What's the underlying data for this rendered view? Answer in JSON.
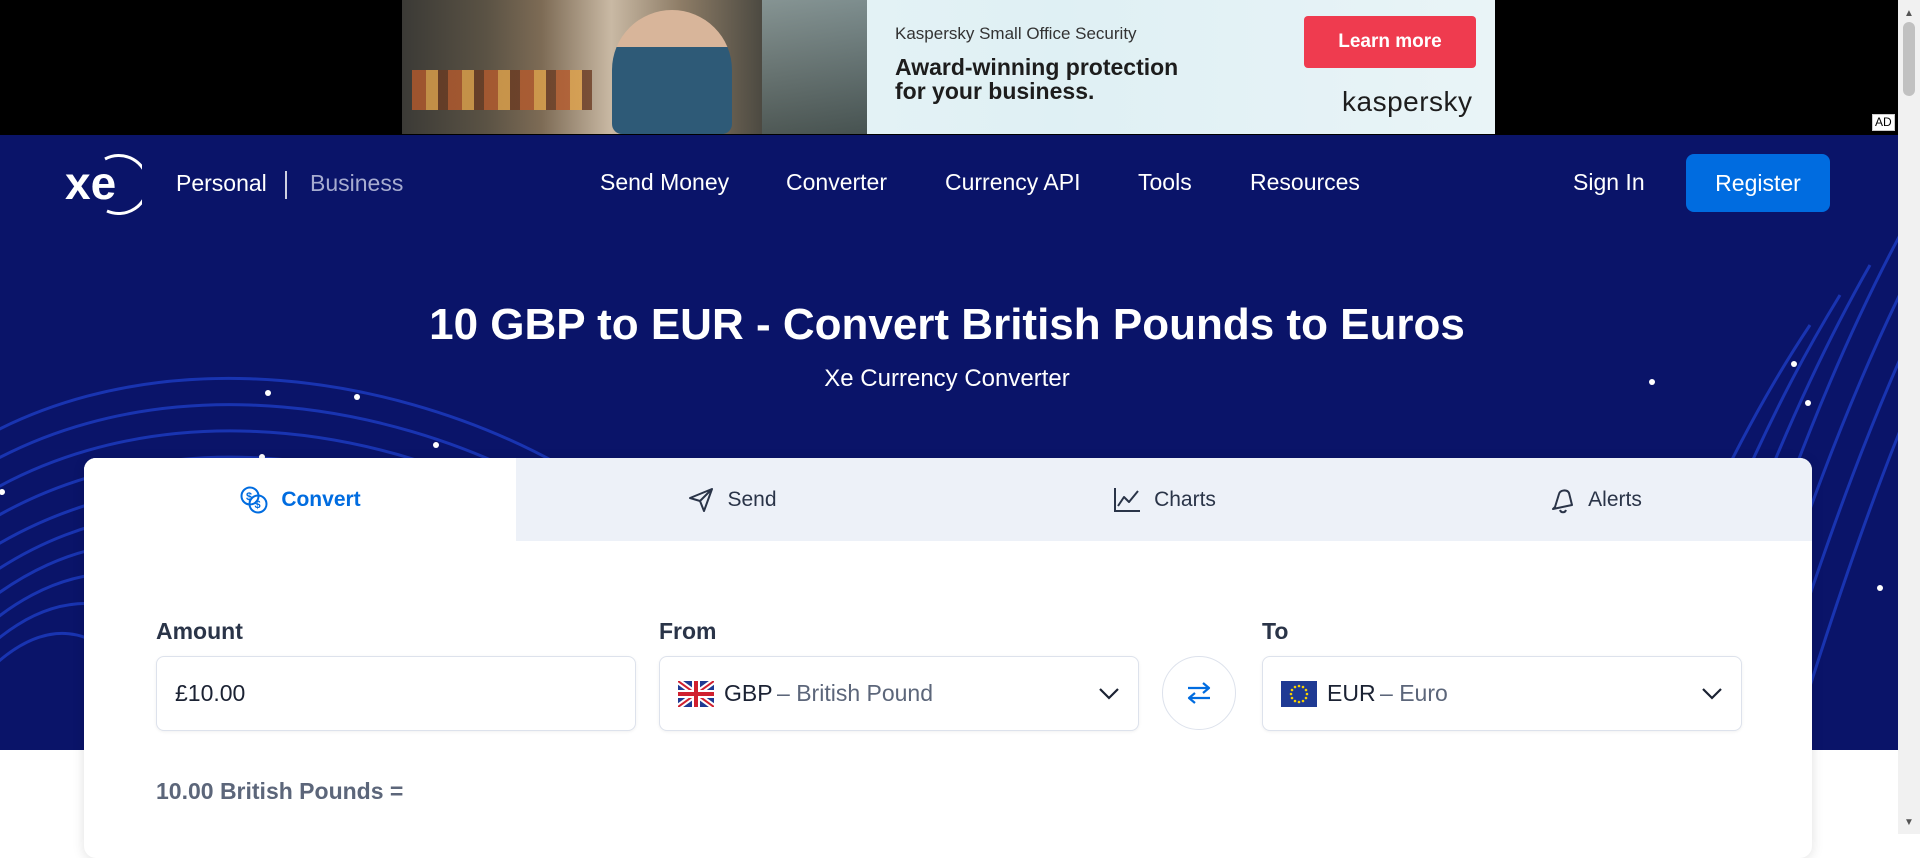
{
  "ad": {
    "small_text": "Kaspersky Small Office Security",
    "headline_line1": "Award-winning protection",
    "headline_line2": "for your business.",
    "cta": "Learn more",
    "brand": "kaspersky",
    "tag": "AD"
  },
  "nav": {
    "logo_text": "xe",
    "personal": "Personal",
    "business": "Business",
    "links": [
      "Send Money",
      "Converter",
      "Currency API",
      "Tools",
      "Resources"
    ],
    "sign_in": "Sign In",
    "register": "Register"
  },
  "hero": {
    "title": "10 GBP to EUR - Convert British Pounds to Euros",
    "subtitle": "Xe Currency Converter"
  },
  "tabs": [
    {
      "label": "Convert",
      "icon": "currency-exchange-icon",
      "active": true
    },
    {
      "label": "Send",
      "icon": "paper-plane-icon",
      "active": false
    },
    {
      "label": "Charts",
      "icon": "line-chart-icon",
      "active": false
    },
    {
      "label": "Alerts",
      "icon": "bell-icon",
      "active": false
    }
  ],
  "converter": {
    "amount_label": "Amount",
    "amount_value": "£10.00",
    "from_label": "From",
    "from_code": "GBP",
    "from_name": "– British Pound",
    "to_label": "To",
    "to_code": "EUR",
    "to_name": "– Euro",
    "result_text": "10.00 British Pounds ="
  },
  "colors": {
    "hero_bg": "#0a1469",
    "accent": "#006ce0",
    "ad_cta": "#ef3b4f"
  }
}
